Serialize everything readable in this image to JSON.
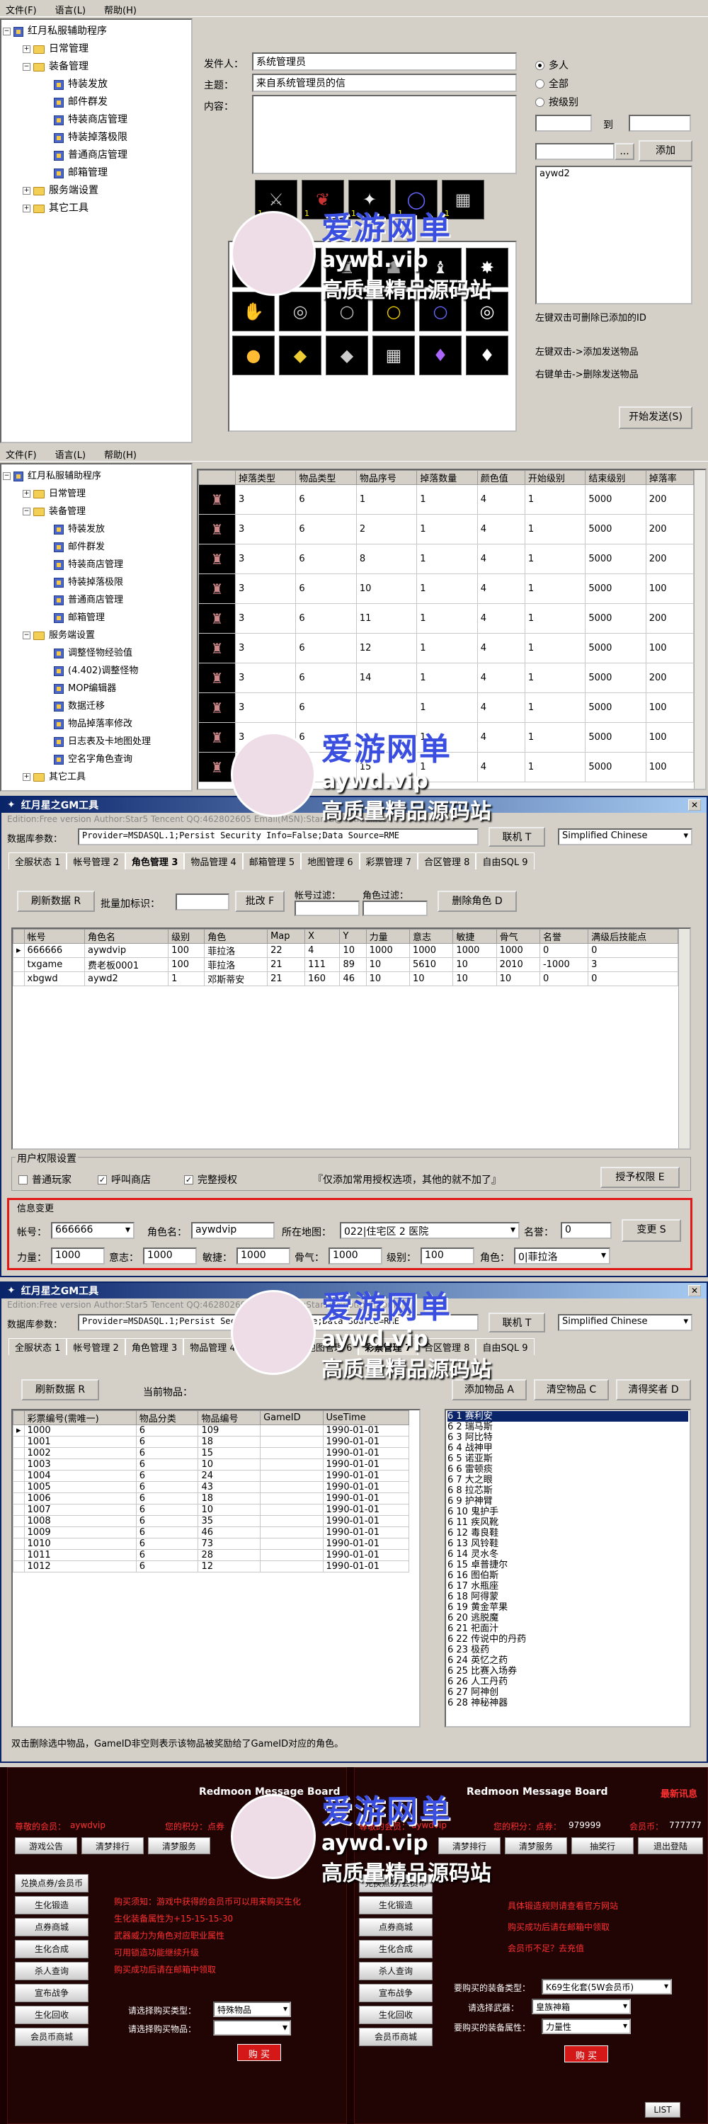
{
  "menu": [
    "文件(F)",
    "语言(L)",
    "帮助(H)"
  ],
  "p1": {
    "title": "红月私服辅助程序",
    "tree": [
      "红月私服辅助程序",
      "日常管理",
      "装备管理",
      "特装发放",
      "邮件群发",
      "特装商店管理",
      "特装掉落极限",
      "普通商店管理",
      "邮箱管理",
      "服务端设置",
      "其它工具"
    ],
    "sender_label": "发件人：",
    "sender": "系统管理员",
    "subject_label": "主题：",
    "subject": "来自系统管理员的信",
    "content_label": "内容：",
    "radio": [
      "多人",
      "全部",
      "按级别"
    ],
    "to_label": "到",
    "add_btn": "添加",
    "recipient": "aywd2",
    "dots": "...",
    "hint1": "左键双击可删除已添加的ID",
    "hint2": "左键双击->添加发送物品",
    "hint3": "右键单击->删除发送物品",
    "send_btn": "开始发送(S)",
    "slot_qty": [
      "1",
      "1",
      "1",
      "1",
      "1"
    ]
  },
  "p2": {
    "tree": [
      "红月私服辅助程序",
      "日常管理",
      "装备管理",
      "特装发放",
      "邮件群发",
      "特装商店管理",
      "特装掉落极限",
      "普通商店管理",
      "邮箱管理",
      "服务端设置",
      "调整怪物经验值",
      "(4.402)调整怪物",
      "MOP编辑器",
      "数据迁移",
      "物品掉落率修改",
      "日志表及卡地图处理",
      "空名字角色查询",
      "其它工具"
    ],
    "headers": [
      "掉落类型",
      "物品类型",
      "物品序号",
      "掉落数量",
      "颜色值",
      "开始级别",
      "结束级别",
      "掉落率"
    ],
    "rows": [
      [
        "3",
        "6",
        "1",
        "1",
        "4",
        "1",
        "5000",
        "200"
      ],
      [
        "3",
        "6",
        "2",
        "1",
        "4",
        "1",
        "5000",
        "200"
      ],
      [
        "3",
        "6",
        "8",
        "1",
        "4",
        "1",
        "5000",
        "200"
      ],
      [
        "3",
        "6",
        "10",
        "1",
        "4",
        "1",
        "5000",
        "100"
      ],
      [
        "3",
        "6",
        "11",
        "1",
        "4",
        "1",
        "5000",
        "200"
      ],
      [
        "3",
        "6",
        "12",
        "1",
        "4",
        "1",
        "5000",
        "100"
      ],
      [
        "3",
        "6",
        "14",
        "1",
        "4",
        "1",
        "5000",
        "200"
      ],
      [
        "3",
        "6",
        "",
        "1",
        "4",
        "1",
        "5000",
        "100"
      ],
      [
        "3",
        "6",
        "",
        "1",
        "4",
        "1",
        "5000",
        "100"
      ],
      [
        "3",
        "6",
        "15",
        "1",
        "4",
        "1",
        "5000",
        "100"
      ]
    ]
  },
  "gm": {
    "title": "红月星之GM工具",
    "edition": "Edition:Free version Author:Star5 Tencent QQ:462802605 Email(MSN):Star5d@hotmail.com",
    "db_label": "数据库参数：",
    "db": "Provider=MSDASQL.1;Persist Security Info=False;Data Source=RME",
    "connect": "联机 T",
    "lang": "Simplified Chinese",
    "tabs": [
      "全服状态 1",
      "帐号管理 2",
      "角色管理 3",
      "物品管理 4",
      "邮箱管理 5",
      "地图管理 6",
      "彩票管理 7",
      "合区管理 8",
      "自由SQL 9"
    ],
    "refresh": "刷新数据 R",
    "batch_label": "批量加标识：",
    "batch_btn": "批改 F",
    "filter_account": "帐号过滤：",
    "filter_role": "角色过滤：",
    "delete_role": "删除角色 D",
    "headers": [
      "帐号",
      "角色名",
      "级别",
      "角色",
      "Map",
      "X",
      "Y",
      "力量",
      "意志",
      "敏捷",
      "骨气",
      "名誉",
      "满级后技能点"
    ],
    "rows": [
      [
        "666666",
        "aywdvip",
        "100",
        "菲拉洛",
        "22",
        "4",
        "10",
        "1000",
        "1000",
        "1000",
        "1000",
        "0",
        "0"
      ],
      [
        "txgame",
        "费老板0001",
        "100",
        "菲拉洛",
        "21",
        "111",
        "89",
        "10",
        "5610",
        "10",
        "2010",
        "-1000",
        "3"
      ],
      [
        "xbgwd",
        "aywd2",
        "1",
        "邓斯蒂安",
        "21",
        "160",
        "46",
        "10",
        "10",
        "10",
        "10",
        "0",
        "0"
      ]
    ],
    "perm_title": "用户权限设置",
    "perm": [
      "普通玩家",
      "呼叫商店",
      "完整授权"
    ],
    "perm_checked": [
      false,
      true,
      true
    ],
    "perm_note": "『仅添加常用授权选项，其他的就不加了』",
    "perm_btn": "授予权限 E",
    "info_title": "信息变更",
    "acc_label": "帐号：",
    "acc": "666666",
    "role_label": "角色名：",
    "role": "aywdvip",
    "map_label": "所在地图：",
    "map": "022|住宅区 2 医院",
    "fame_label": "名誉：",
    "fame": "0",
    "change_btn": "变更 S",
    "str_label": "力量：",
    "str": "1000",
    "will_label": "意志：",
    "will": "1000",
    "agi_label": "敏捷：",
    "agi": "1000",
    "bone_label": "骨气：",
    "bone": "1000",
    "lvl_label": "级别：",
    "lvl": "100",
    "cls_label": "角色：",
    "cls": "0|菲拉洛"
  },
  "gm2": {
    "title": "红月星之GM工具",
    "tabs": [
      "全服状态 1",
      "帐号管理 2",
      "角色管理 3",
      "物品管理 4",
      "邮箱管理 5",
      "地图管理 6",
      "彩票管理 7",
      "合区管理 8",
      "自由SQL 9"
    ],
    "refresh": "刷新数据 R",
    "current": "当前物品：",
    "add": "添加物品 A",
    "clear": "清空物品 C",
    "clear_bonus": "清得奖者 D",
    "headers": [
      "彩票编号(需唯一)",
      "物品分类",
      "物品编号",
      "GameID",
      "UseTime"
    ],
    "rows": [
      [
        "1000",
        "6",
        "109",
        "",
        "1990-01-01"
      ],
      [
        "1001",
        "6",
        "18",
        "",
        "1990-01-01"
      ],
      [
        "1002",
        "6",
        "15",
        "",
        "1990-01-01"
      ],
      [
        "1003",
        "6",
        "10",
        "",
        "1990-01-01"
      ],
      [
        "1004",
        "6",
        "24",
        "",
        "1990-01-01"
      ],
      [
        "1005",
        "6",
        "43",
        "",
        "1990-01-01"
      ],
      [
        "1006",
        "6",
        "18",
        "",
        "1990-01-01"
      ],
      [
        "1007",
        "6",
        "10",
        "",
        "1990-01-01"
      ],
      [
        "1008",
        "6",
        "35",
        "",
        "1990-01-01"
      ],
      [
        "1009",
        "6",
        "46",
        "",
        "1990-01-01"
      ],
      [
        "1010",
        "6",
        "73",
        "",
        "1990-01-01"
      ],
      [
        "1011",
        "6",
        "28",
        "",
        "1990-01-01"
      ],
      [
        "1012",
        "6",
        "12",
        "",
        "1990-01-01"
      ]
    ],
    "items": [
      "6 1 赛利安",
      "6 2 瑞马斯",
      "6 3 阿比特",
      "6 4 战神甲",
      "6 5 诺亚斯",
      "6 6 雷顿痰",
      "6 7 大之眼",
      "6 8 拉芯斯",
      "6 9 护神臂",
      "6 10 鬼护手",
      "6 11 疾风靴",
      "6 12 毒良鞋",
      "6 13 风铃鞋",
      "6 14 灵水冬",
      "6 15 卓普捷尔",
      "6 16 图伯斯",
      "6 17 水瓶座",
      "6 18 阿得蒙",
      "6 19 黄金苹果",
      "6 20 逃脱魔",
      "6 21 祀面汁",
      "6 22 传说中的丹药",
      "6 23 极药",
      "6 24 英忆之药",
      "6 25 比赛入场券",
      "6 26 人工丹药",
      "6 27 阿神创",
      "6 28 神秘神器"
    ],
    "footer": "双击删除选中物品，GameID非空则表示该物品被奖励给了GameID对应的角色。"
  },
  "rm": {
    "title": "Redmoon Message Board",
    "news": "最新讯息",
    "left_info": [
      "尊敬的会员：",
      "aywdvip",
      "您的积分：点券",
      "会员币："
    ],
    "right_info": [
      "尊敬的会员：",
      "aywdvip",
      "您的积分：点券：",
      "979999",
      "会员币：",
      "777777"
    ],
    "nav": [
      "游戏公告",
      "清梦排行",
      "清梦服务",
      "抽奖行",
      "退出登陆"
    ],
    "side": [
      "兑换点券/会员币",
      "生化锻造",
      "点券商城",
      "生化合成",
      "杀人查询",
      "宣布战争",
      "生化回收",
      "会员币商城"
    ],
    "left_msgs": [
      "购买须知：游戏中获得的会员币可以用来购买生化",
      "生化装备属性为+15-15-15-30",
      "武器威力为角色对应职业属性",
      "可用锁造功能继续升级",
      "购买成功后请在邮箱中领取"
    ],
    "right_msgs": [
      "具体锻造规则请查看官方网站",
      "购买成功后请在邮箱中领取",
      "会员币不足？去充值"
    ],
    "buy_cat": "请选择购买类型：",
    "buy_cat_val": "特殊物品",
    "buy_item": "请选择购买物品：",
    "buy_btn": "购 买",
    "gear_label": "要购买的装备类型：",
    "gear_val": "K69生化套(5W会员币)",
    "weapon_label": "请选择武器：",
    "weapon_val": "皇族神箱",
    "attr_label": "要购买的装备属性：",
    "attr_val": "力量性",
    "list": "LIST"
  },
  "wm": {
    "t1": "爱游网单",
    "t2": "aywd.vip",
    "t3": "高质量精品源码站"
  },
  "colors": {
    "titleStart": "#0a246a",
    "titleEnd": "#a6caf0",
    "highlight": "#0a246a",
    "dark": "#1a0000"
  }
}
